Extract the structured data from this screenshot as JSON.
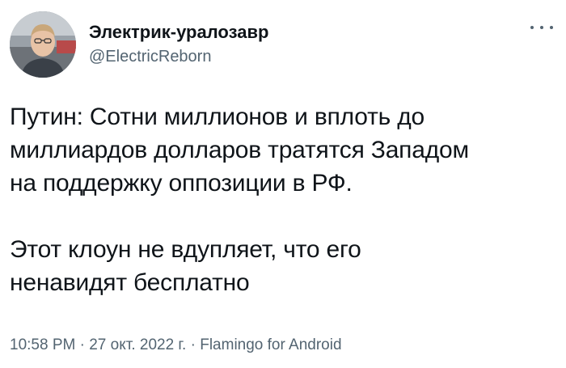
{
  "author": {
    "display_name": "Электрик-уралозавр",
    "handle": "@ElectricReborn",
    "avatar_icon": "user-photo-avatar"
  },
  "more_icon": "more-horizontal-icon",
  "tweet": {
    "paragraph_1": "Путин: Сотни миллионов и вплоть до\nмиллиардов долларов тратятся Западом\nна поддержку оппозиции в РФ.",
    "paragraph_2": "Этот клоун не вдупляет, что его\nненавидят бесплатно"
  },
  "meta": {
    "time": "10:58 PM",
    "separator_1": " · ",
    "date": "27 окт. 2022 г.",
    "separator_2": " · ",
    "source": "Flamingo for Android"
  },
  "colors": {
    "text_primary": "#0f1419",
    "text_secondary": "#536471",
    "background": "#ffffff"
  }
}
